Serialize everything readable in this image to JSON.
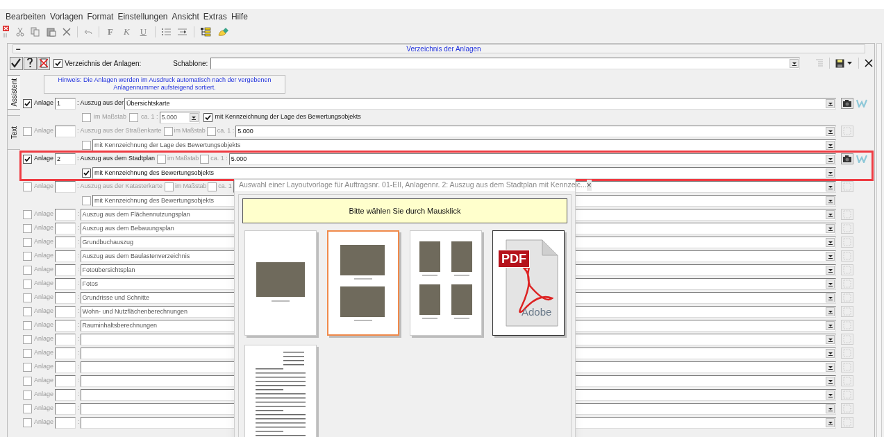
{
  "menu": [
    "Bearbeiten",
    "Vorlagen",
    "Format",
    "Einstellungen",
    "Ansicht",
    "Extras",
    "Hilfe"
  ],
  "format_buttons": [
    "F",
    "K",
    "U"
  ],
  "panel": {
    "collapse": "−",
    "title": "Verzeichnis der Anlagen"
  },
  "header": {
    "list_checked": true,
    "list_label": "Verzeichnis der Anlagen:",
    "template_label": "Schablone:"
  },
  "side_tabs": [
    {
      "label": "Assistent",
      "selected": true
    },
    {
      "label": "Text",
      "selected": false
    }
  ],
  "hint": "Hinweis: Die Anlagen werden im Ausdruck automatisch nach der vergebenen Anlagennummer aufsteigend sortiert.",
  "rows": [
    {
      "kind": "inline",
      "checked": true,
      "highlighted": false,
      "label": "Anlage",
      "number": "1",
      "caption": ": Auszug aus der",
      "value": "Übersichtskarte",
      "scale_checked": false,
      "scale_label": "im Maßstab",
      "approx_checked": false,
      "approx_label": "ca. 1 :",
      "scale": "5.000",
      "mark_checked": true,
      "mark": "mit Kennzeichnung der Lage des Bewertungsobjekts"
    },
    {
      "kind": "map",
      "checked": false,
      "highlighted": false,
      "label": "Anlage",
      "caption": ": Auszug aus der Straßenkarte",
      "scale_checked": false,
      "scale_label": "im Maßstab",
      "approx_checked": false,
      "approx_label": "ca. 1 :",
      "scale": "5.000",
      "mark_checked": false,
      "mark": "mit Kennzeichnung der Lage des Bewertungsobjekts"
    },
    {
      "kind": "map",
      "checked": true,
      "highlighted": true,
      "label": "Anlage",
      "number": "2",
      "caption": ": Auszug aus dem Stadtplan",
      "scale_checked": false,
      "scale_label": "im Maßstab",
      "approx_checked": false,
      "approx_label": "ca. 1 :",
      "scale": "5.000",
      "mark_checked": true,
      "mark": "mit Kennzeichnung des Bewertungsobjekts"
    },
    {
      "kind": "map",
      "checked": false,
      "highlighted": false,
      "label": "Anlage",
      "caption": ": Auszug aus der Katasterkarte",
      "scale_checked": false,
      "scale_label": "im Maßstab",
      "approx_checked": false,
      "approx_label": "ca. 1",
      "mark_checked": false,
      "mark": "mit Kennzeichnung des Bewertungsobjekts"
    },
    {
      "kind": "simple",
      "checked": false,
      "label": "Anlage",
      "separator": ":",
      "value": "Auszug aus dem Flächennutzungsplan"
    },
    {
      "kind": "simple",
      "checked": false,
      "label": "Anlage",
      "separator": ":",
      "value": "Auszug aus dem Bebauungsplan"
    },
    {
      "kind": "simple",
      "checked": false,
      "label": "Anlage",
      "separator": ":",
      "value": "Grundbuchauszug"
    },
    {
      "kind": "simple",
      "checked": false,
      "label": "Anlage",
      "separator": ":",
      "value": "Auszug aus dem Baulastenverzeichnis"
    },
    {
      "kind": "simple",
      "checked": false,
      "label": "Anlage",
      "separator": ":",
      "value": "Fotoübersichtsplan"
    },
    {
      "kind": "simple",
      "checked": false,
      "label": "Anlage",
      "separator": ":",
      "value": "Fotos"
    },
    {
      "kind": "simple",
      "checked": false,
      "label": "Anlage",
      "separator": ":",
      "value": "Grundrisse und Schnitte"
    },
    {
      "kind": "simple",
      "checked": false,
      "label": "Anlage",
      "separator": ":",
      "value": "Wohn- und Nutzflächenberechnungen"
    },
    {
      "kind": "simple",
      "checked": false,
      "label": "Anlage",
      "separator": ":",
      "value": "Rauminhaltsberechnungen"
    },
    {
      "kind": "simple",
      "checked": false,
      "label": "Anlage",
      "separator": ":"
    },
    {
      "kind": "simple",
      "checked": false,
      "label": "Anlage",
      "separator": ":"
    },
    {
      "kind": "simple",
      "checked": false,
      "label": "Anlage",
      "separator": ":"
    },
    {
      "kind": "simple",
      "checked": false,
      "label": "Anlage",
      "separator": ":"
    },
    {
      "kind": "simple",
      "checked": false,
      "label": "Anlage",
      "separator": ":"
    },
    {
      "kind": "simple",
      "checked": false,
      "label": "Anlage",
      "separator": ":"
    },
    {
      "kind": "simple",
      "checked": false,
      "label": "Anlage",
      "separator": ":"
    }
  ],
  "dialog": {
    "title": "Auswahl einer Layoutvorlage für Auftragsnr. 01-EII, Anlagennr. 2: Auszug aus dem Stadtplan mit Kennzeic...",
    "close": "×",
    "prompt": "Bitte wählen Sie durch Mausklick",
    "templates": [
      {
        "kind": "one_photo",
        "selected": false
      },
      {
        "kind": "two_photos",
        "selected": true
      },
      {
        "kind": "four_photos",
        "selected": false
      },
      {
        "kind": "pdf",
        "selected": false,
        "label": "PDF",
        "brand": "Adobe"
      },
      {
        "kind": "letter",
        "selected": false
      }
    ]
  }
}
